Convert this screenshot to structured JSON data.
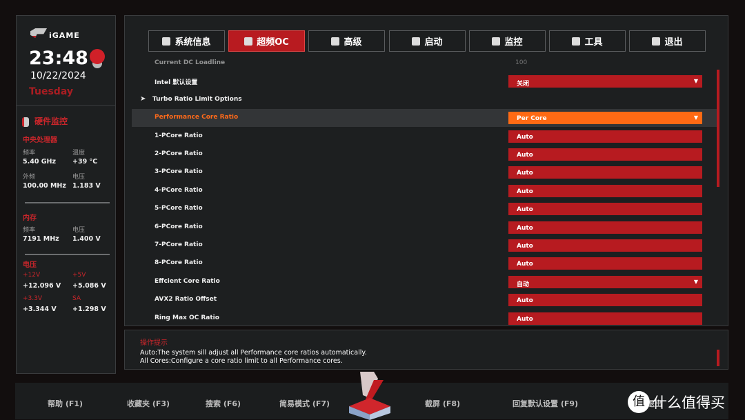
{
  "brand": "iGAME",
  "clock": {
    "time": "23:48",
    "date": "10/22/2024",
    "day": "Tuesday"
  },
  "monitor": {
    "title": "硬件监控",
    "cpu": {
      "title": "中央处理器",
      "freq_label": "频率",
      "freq": "5.40 GHz",
      "temp_label": "温度",
      "temp": "+39 °C",
      "bclk_label": "外频",
      "bclk": "100.00 MHz",
      "volt_label": "电压",
      "volt": "1.183 V"
    },
    "memory": {
      "title": "内存",
      "freq_label": "频率",
      "freq": "7191 MHz",
      "volt_label": "电压",
      "volt": "1.400 V"
    },
    "voltage": {
      "title": "电压",
      "v12_label": "+12V",
      "v12": "+12.096 V",
      "v5_label": "+5V",
      "v5": "+5.086 V",
      "v33_label": "+3.3V",
      "v33": "+3.344 V",
      "sa_label": "SA",
      "sa": "+1.298 V"
    }
  },
  "tabs": [
    {
      "label": "系统信息"
    },
    {
      "label": "超频OC",
      "active": true
    },
    {
      "label": "高级"
    },
    {
      "label": "启动"
    },
    {
      "label": "监控"
    },
    {
      "label": "工具"
    },
    {
      "label": "退出"
    }
  ],
  "settings": [
    {
      "name": "Current DC Loadline",
      "value": "100",
      "type": "text"
    },
    {
      "name": "Intel 默认设置",
      "value": "关闭",
      "type": "dropdown"
    },
    {
      "name": "Turbo Ratio Limit Options",
      "type": "submenu"
    },
    {
      "name": "Performance Core Ratio",
      "value": "Per Core",
      "type": "dropdown",
      "selected": true
    },
    {
      "name": "1-PCore Ratio",
      "value": "Auto",
      "type": "input"
    },
    {
      "name": "2-PCore Ratio",
      "value": "Auto",
      "type": "input"
    },
    {
      "name": "3-PCore Ratio",
      "value": "Auto",
      "type": "input"
    },
    {
      "name": "4-PCore Ratio",
      "value": "Auto",
      "type": "input"
    },
    {
      "name": "5-PCore Ratio",
      "value": "Auto",
      "type": "input"
    },
    {
      "name": "6-PCore Ratio",
      "value": "Auto",
      "type": "input"
    },
    {
      "name": "7-PCore Ratio",
      "value": "Auto",
      "type": "input"
    },
    {
      "name": "8-PCore Ratio",
      "value": "Auto",
      "type": "input"
    },
    {
      "name": "Effcient Core Ratio",
      "value": "自动",
      "type": "dropdown"
    },
    {
      "name": "AVX2 Ratio Offset",
      "value": "Auto",
      "type": "input"
    },
    {
      "name": "Ring Max OC Ratio",
      "value": "Auto",
      "type": "input"
    }
  ],
  "help": {
    "title": "操作提示",
    "lines": [
      "Auto:The system sill adjust all Performance core ratios automatically.",
      "All Cores:Configure a core ratio limit to all Performance cores."
    ]
  },
  "footer": [
    {
      "label": "帮助 (F1)"
    },
    {
      "label": "收藏夹 (F3)"
    },
    {
      "label": "搜索 (F6)"
    },
    {
      "label": "简易模式 (F7)"
    },
    {
      "label": "截屏 (F8)"
    },
    {
      "label": "回复默认设置 (F9)"
    },
    {
      "label": "并退出"
    }
  ],
  "watermark": "什么值得买",
  "colors": {
    "accent": "#b71b20",
    "selected": "#ff6a14",
    "bg": "#1d1f20"
  }
}
